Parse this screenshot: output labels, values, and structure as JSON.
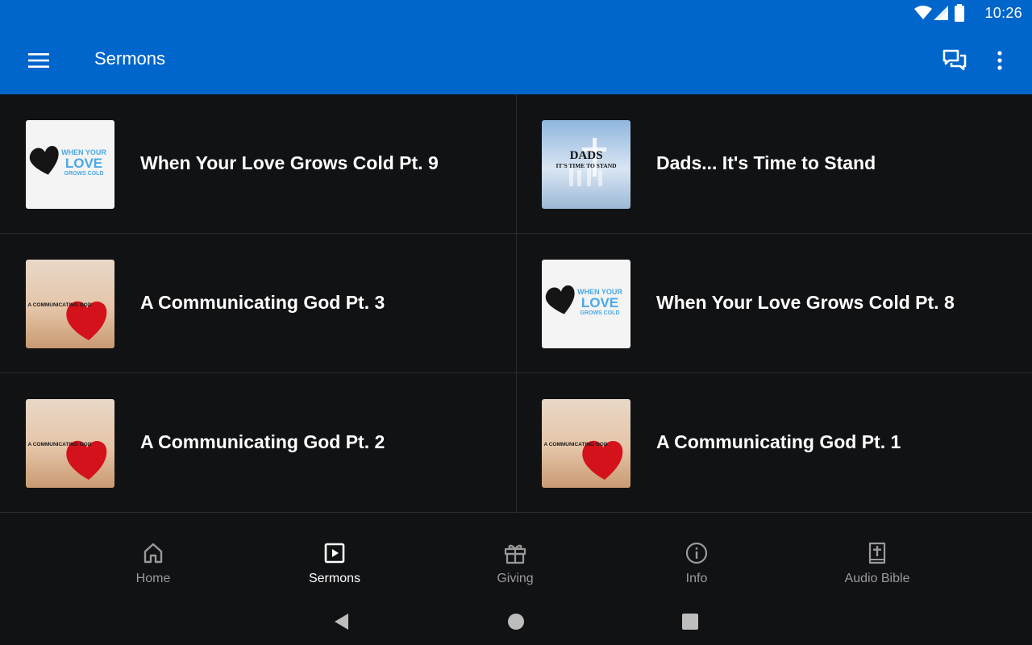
{
  "status_bar": {
    "time": "10:26"
  },
  "app_bar": {
    "title": "Sermons"
  },
  "sermons": [
    {
      "title": "When Your Love Grows Cold Pt. 9",
      "thumb": "love-grows-cold",
      "thumb_text": [
        "WHEN YOUR",
        "LOVE",
        "GROWS COLD"
      ]
    },
    {
      "title": "Dads... It's Time to Stand",
      "thumb": "dads",
      "thumb_text": [
        "DADS",
        "IT'S TIME TO STAND"
      ]
    },
    {
      "title": "A Communicating God Pt. 3",
      "thumb": "communicating-god",
      "thumb_text": [
        "A COMMUNICATING GOD"
      ]
    },
    {
      "title": "When Your Love Grows Cold Pt. 8",
      "thumb": "love-grows-cold",
      "thumb_text": [
        "WHEN YOUR",
        "LOVE",
        "GROWS COLD"
      ]
    },
    {
      "title": "A Communicating God Pt. 2",
      "thumb": "communicating-god",
      "thumb_text": [
        "A COMMUNICATING GOD"
      ]
    },
    {
      "title": "A Communicating God Pt. 1",
      "thumb": "communicating-god",
      "thumb_text": [
        "A COMMUNICATING GOD"
      ]
    }
  ],
  "bottom_nav": {
    "items": [
      {
        "label": "Home",
        "icon": "home-icon"
      },
      {
        "label": "Sermons",
        "icon": "play-box-icon",
        "active": true
      },
      {
        "label": "Giving",
        "icon": "gift-icon"
      },
      {
        "label": "Info",
        "icon": "info-icon"
      },
      {
        "label": "Audio Bible",
        "icon": "bible-icon"
      }
    ]
  },
  "colors": {
    "app_bar": "#0066CC",
    "background": "#111214",
    "active_nav": "#ffffff",
    "inactive_nav": "#9a9a9a",
    "love_text": "#4aa8e8",
    "heart_red": "#d3121c"
  }
}
